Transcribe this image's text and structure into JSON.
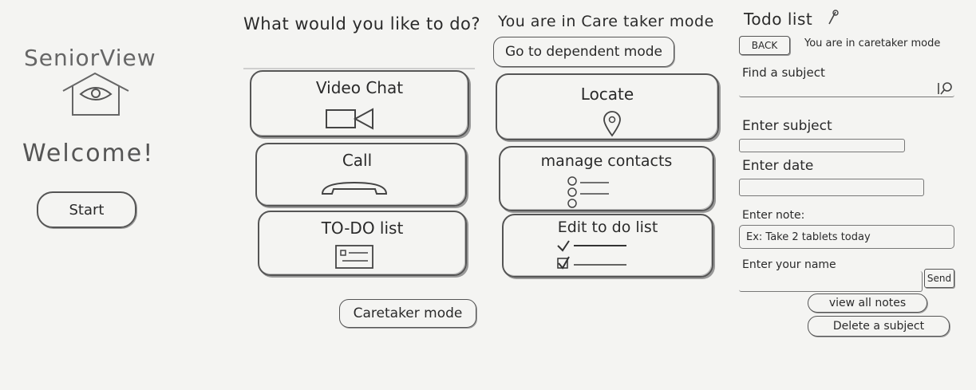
{
  "welcome_panel": {
    "app_name": "SeniorView",
    "welcome_text": "Welcome!",
    "start_label": "Start"
  },
  "main_menu": {
    "heading": "What would you like to do?",
    "video_chat_label": "Video Chat",
    "call_label": "Call",
    "todo_label": "TO-DO list",
    "caretaker_mode_label": "Caretaker mode"
  },
  "caretaker_menu": {
    "heading": "You are in Care taker mode",
    "dependent_mode_label": "Go to dependent mode",
    "locate_label": "Locate",
    "manage_contacts_label": "manage contacts",
    "edit_todo_label": "Edit to do list"
  },
  "todo_panel": {
    "title": "Todo list",
    "back_label": "BACK",
    "mode_note": "You are in caretaker mode",
    "find_subject_label": "Find a subject",
    "enter_subject_label": "Enter subject",
    "enter_date_label": "Enter date",
    "enter_note_label": "Enter note:",
    "note_placeholder": "Ex: Take 2 tablets today",
    "enter_name_label": "Enter your name",
    "send_label": "Send",
    "view_all_label": "view all notes",
    "delete_label": "Delete a subject"
  },
  "icons": {
    "house_eye": "house-eye-icon",
    "camera": "video-camera-icon",
    "phone": "phone-icon",
    "list": "list-icon",
    "pin": "location-pin-icon",
    "contacts": "contacts-icon",
    "checklist": "checklist-icon",
    "search": "search-icon",
    "pencil": "pencil-icon"
  }
}
